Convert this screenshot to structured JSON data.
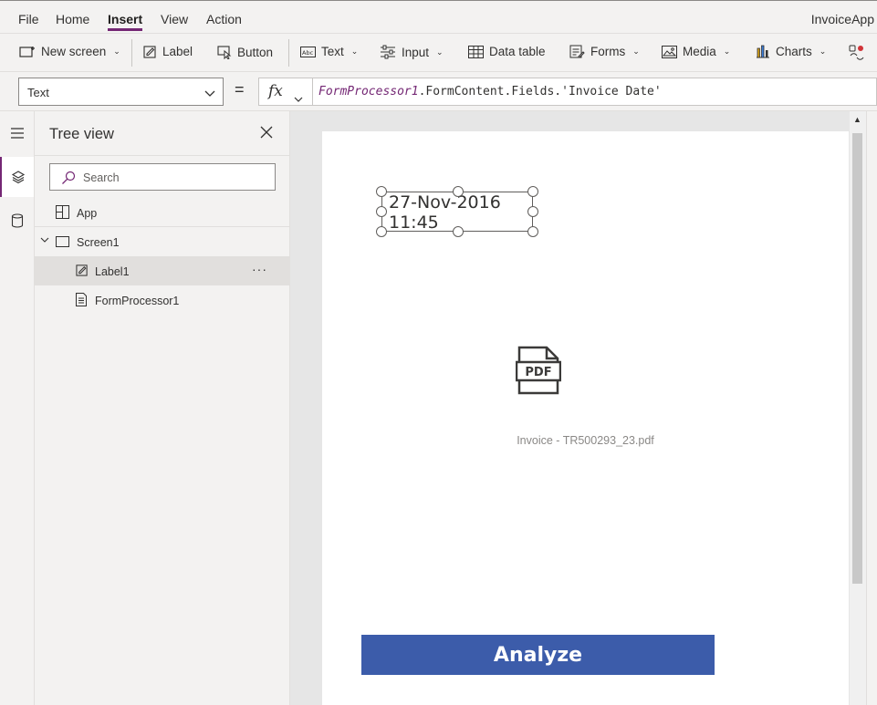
{
  "menu": {
    "items": [
      {
        "label": "File"
      },
      {
        "label": "Home"
      },
      {
        "label": "Insert"
      },
      {
        "label": "View"
      },
      {
        "label": "Action"
      }
    ],
    "active": "Insert",
    "app_name": "InvoiceApp"
  },
  "ribbon": {
    "new_screen": "New screen",
    "label": "Label",
    "button": "Button",
    "text": "Text",
    "input": "Input",
    "data_table": "Data table",
    "forms": "Forms",
    "media": "Media",
    "charts": "Charts"
  },
  "formula_bar": {
    "property": "Text",
    "equals": "=",
    "fx": "fx",
    "formula_control": "FormProcessor1",
    "formula_rest": ".FormContent.Fields.'Invoice Date'"
  },
  "tree_view": {
    "title": "Tree view",
    "search_placeholder": "Search",
    "nodes": [
      {
        "label": "App"
      },
      {
        "label": "Screen1"
      },
      {
        "label": "Label1"
      },
      {
        "label": "FormProcessor1"
      }
    ],
    "more": "···"
  },
  "canvas": {
    "label_text_line1": "27-Nov-2016",
    "label_text_line2": "11:45",
    "pdf_badge": "PDF",
    "pdf_filename": "Invoice - TR500293_23.pdf",
    "analyze_button": "Analyze"
  },
  "colors": {
    "accent": "#742774",
    "analyze_button": "#3c5caa"
  },
  "icons": [
    "hamburger-icon",
    "layers-icon",
    "database-icon",
    "close-icon",
    "search-icon",
    "pdf-file-icon"
  ]
}
